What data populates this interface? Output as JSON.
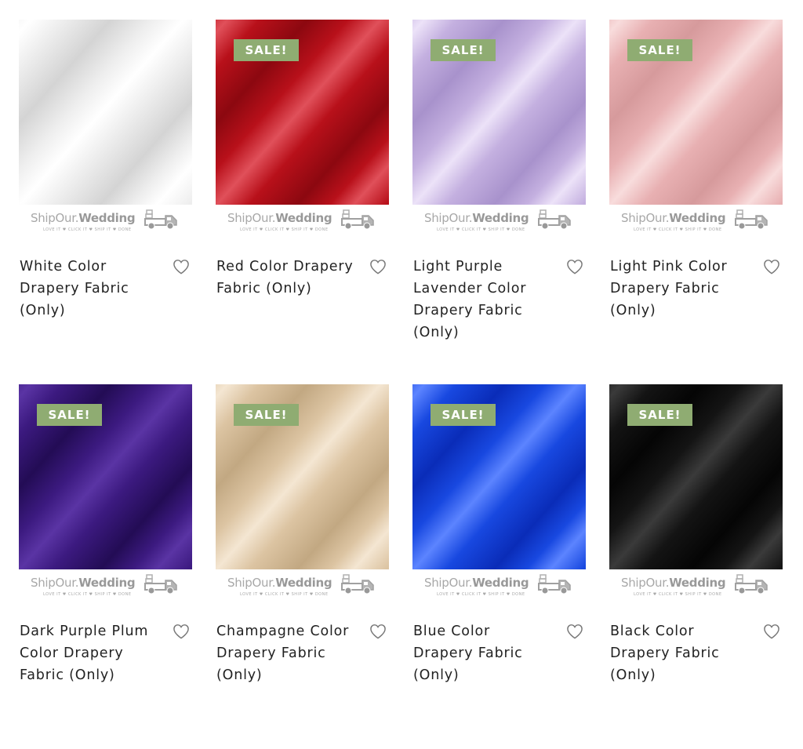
{
  "brand": {
    "name_light": "ShipOur.",
    "name_bold": "Wedding",
    "tagline": "LOVE IT ♥ CLICK IT ♥ SHIP IT ♥ DONE"
  },
  "products": [
    {
      "title": "White Color Drapery Fabric (Only)",
      "sale": "",
      "color": "#eeeeee",
      "dark": "#d4d4d4",
      "light": "#ffffff"
    },
    {
      "title": "Red Color Drapery Fabric (Only)",
      "sale": "SALE!",
      "color": "#b8101a",
      "dark": "#8c0810",
      "light": "#e0505a"
    },
    {
      "title": "Light Purple Lavender Color Drapery Fabric (Only)",
      "sale": "SALE!",
      "color": "#c4b0e0",
      "dark": "#a892cc",
      "light": "#ece2f8"
    },
    {
      "title": "Light Pink Color Drapery Fabric (Only)",
      "sale": "SALE!",
      "color": "#e8b0b2",
      "dark": "#d69a9c",
      "light": "#f8dcdc"
    },
    {
      "title": "Dark Purple Plum Color Drapery Fabric (Only)",
      "sale": "SALE!",
      "color": "#3c1a80",
      "dark": "#230c55",
      "light": "#5a34a4"
    },
    {
      "title": "Champagne Color Drapery Fabric (Only)",
      "sale": "SALE!",
      "color": "#dcc4a2",
      "dark": "#c2a882",
      "light": "#f4e6d2"
    },
    {
      "title": "Blue Color Drapery Fabric (Only)",
      "sale": "SALE!",
      "color": "#1848e0",
      "dark": "#0a2cb8",
      "light": "#5c84ff"
    },
    {
      "title": "Black Color Drapery Fabric (Only)",
      "sale": "SALE!",
      "color": "#141414",
      "dark": "#050505",
      "light": "#3a3a3a"
    }
  ]
}
